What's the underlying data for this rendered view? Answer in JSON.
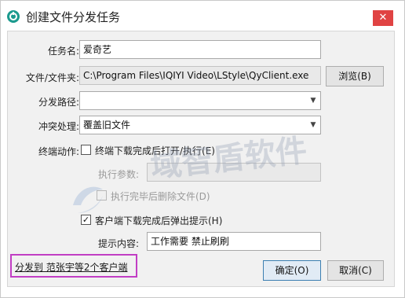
{
  "window": {
    "title": "创建文件分发任务",
    "close_label": "✕",
    "icon": "app-logo-icon"
  },
  "form": {
    "task_name_label": "任务名:",
    "task_name_value": "爱奇艺",
    "file_label": "文件/文件夹:",
    "file_value": "C:\\Program Files\\IQIYI Video\\LStyle\\QyClient.exe",
    "browse_label": "浏览(B)",
    "path_label": "分发路径:",
    "path_value": "",
    "conflict_label": "冲突处理:",
    "conflict_value": "覆盖旧文件",
    "terminal_action_label": "终端动作:",
    "open_after_download_label": "终端下载完成后打开/执行(E)",
    "open_after_download_checked": false,
    "exec_params_label": "执行参数:",
    "exec_params_value": "",
    "delete_after_exec_label": "执行完毕后删除文件(D)",
    "delete_after_exec_checked": false,
    "popup_prompt_label": "客户端下载完成后弹出提示(H)",
    "popup_prompt_checked": true,
    "prompt_content_label": "提示内容:",
    "prompt_content_value": "工作需要 禁止刷刷"
  },
  "footer": {
    "distribute_link": "分发到 范张宇等2个客户端",
    "ok_label": "确定(O)",
    "cancel_label": "取消(C)"
  },
  "watermark": {
    "text": "域智盾软件"
  },
  "colors": {
    "close_button": "#e04343",
    "app_icon": "#1b9a8e",
    "highlight_box": "#c13ec4",
    "primary_button_border": "#3c7fb1"
  }
}
